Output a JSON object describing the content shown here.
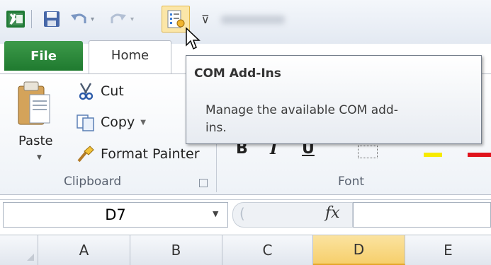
{
  "tabs": {
    "file": "File",
    "home": "Home"
  },
  "clipboard": {
    "paste_label": "Paste",
    "cut_label": "Cut",
    "copy_label": "Copy",
    "format_painter_label": "Format Painter",
    "group_label": "Clipboard"
  },
  "font_group": {
    "group_label": "Font",
    "bold_glyph": "B",
    "italic_glyph": "I",
    "underline_glyph": "U"
  },
  "formula_bar": {
    "name_box_value": "D7",
    "fx_label": "fx"
  },
  "columns": [
    {
      "label": "A",
      "selected": false
    },
    {
      "label": "B",
      "selected": false
    },
    {
      "label": "C",
      "selected": false
    },
    {
      "label": "D",
      "selected": true
    },
    {
      "label": "E",
      "selected": false
    }
  ],
  "tooltip": {
    "title": "COM Add-Ins",
    "description": "Manage the available COM add-ins."
  },
  "colors": {
    "file_tab_green": "#217a33",
    "selected_column": "#f6cf6c",
    "tooltip_border": "#767f8c"
  }
}
